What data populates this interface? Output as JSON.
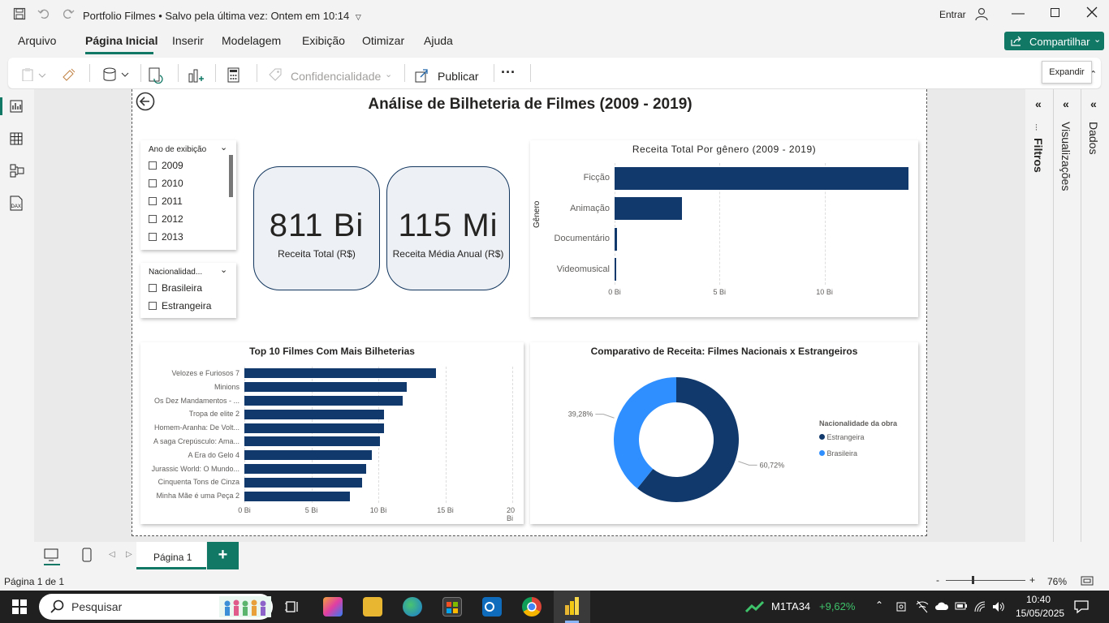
{
  "window": {
    "title": "Portfolio Filmes",
    "save_status": "Salvo pela última vez: Ontem em 10:14",
    "signin": "Entrar"
  },
  "menu": {
    "items": [
      "Arquivo",
      "Página Inicial",
      "Inserir",
      "Modelagem",
      "Exibição",
      "Otimizar",
      "Ajuda"
    ],
    "active": "Página Inicial",
    "share_label": "Compartilhar"
  },
  "ribbon": {
    "confidencialidade": "Confidencialidade",
    "publicar": "Publicar",
    "more": "···"
  },
  "tooltip": "Expandir",
  "report": {
    "title": "Análise de Bilheteria de Filmes (2009 - 2019)",
    "slicer_year": {
      "title": "Ano de exibição",
      "options": [
        "2009",
        "2010",
        "2011",
        "2012",
        "2013"
      ]
    },
    "slicer_nat": {
      "title": "Nacionalidad...",
      "options": [
        "Brasileira",
        "Estrangeira"
      ]
    },
    "kpi1": {
      "value": "811 Bi",
      "label": "Receita Total (R$)"
    },
    "kpi2": {
      "value": "115 Mi",
      "label": "Receita Média Anual (R$)"
    }
  },
  "chart_data": [
    {
      "type": "bar",
      "orientation": "horizontal",
      "title": "Receita Total Por gênero (2009 - 2019)",
      "ylabel": "Gênero",
      "xlabel": "",
      "categories": [
        "Ficção",
        "Animação",
        "Documentário",
        "Videomusical"
      ],
      "values": [
        14.0,
        3.2,
        0.1,
        0.05
      ],
      "x_ticks": [
        "0 Bi",
        "5 Bi",
        "10 Bi"
      ],
      "xlim": [
        0,
        14
      ],
      "color": "#12396b"
    },
    {
      "type": "bar",
      "orientation": "horizontal",
      "title": "Top 10 Filmes Com Mais Bilheterias",
      "categories": [
        "Velozes e Furiosos 7",
        "Minions",
        "Os Dez Mandamentos - ...",
        "Tropa de elite 2",
        "Homem-Aranha: De Volt...",
        "A saga Crepúsculo: Ama...",
        "A Era do Gelo 4",
        "Jurassic World: O Mundo...",
        "Cinquenta Tons de Cinza",
        "Minha Mãe é uma Peça 2"
      ],
      "values": [
        14.3,
        12.1,
        11.8,
        10.4,
        10.4,
        10.1,
        9.5,
        9.1,
        8.8,
        7.9
      ],
      "x_ticks": [
        "0 Bi",
        "5 Bi",
        "10 Bi",
        "15 Bi",
        "20 Bi"
      ],
      "xlim": [
        0,
        20
      ],
      "color": "#12396b"
    },
    {
      "type": "pie",
      "donut": true,
      "title": "Comparativo de Receita: Filmes Nacionais x Estrangeiros",
      "legend_title": "Nacionalidade da obra",
      "legend_position": "right",
      "slices": [
        {
          "name": "Estrangeira",
          "value": 60.72,
          "label": "60,72%",
          "color": "#12396b"
        },
        {
          "name": "Brasileira",
          "value": 39.28,
          "label": "39,28%",
          "color": "#2f8fff"
        }
      ]
    }
  ],
  "side": {
    "filtros": "Filtros",
    "visualizacoes": "Visualizações",
    "dados": "Dados"
  },
  "tabs": {
    "page": "Página 1",
    "add": "+"
  },
  "status": {
    "page_count": "Página 1 de 1",
    "zoom": "76%",
    "minus": "-",
    "plus": "+"
  },
  "taskbar": {
    "search": "Pesquisar",
    "stock_name": "M1TA34",
    "stock_change": "+9,62%",
    "time": "10:40",
    "date": "15/05/2025"
  }
}
